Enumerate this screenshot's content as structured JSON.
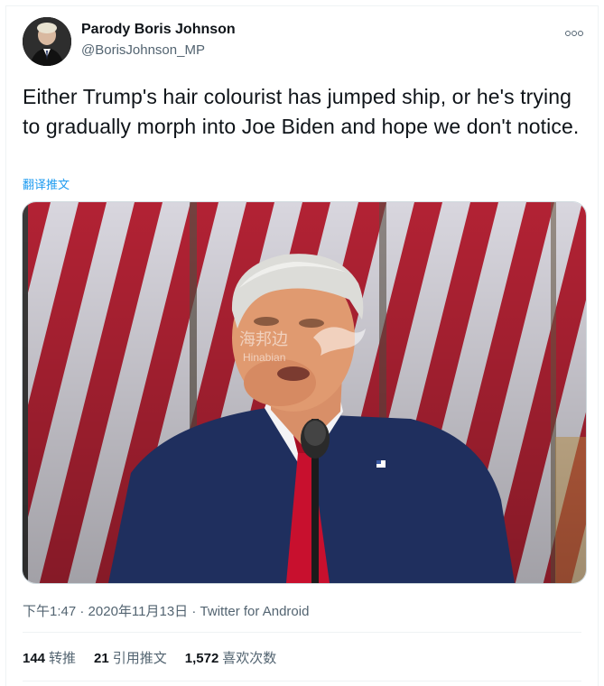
{
  "tweet": {
    "display_name": "Parody Boris Johnson",
    "handle": "@BorisJohnson_MP",
    "text": "Either Trump's hair colourist has jumped ship, or he's trying to gradually morph into Joe Biden and hope we don't notice.",
    "translate_label": "翻译推文",
    "time": "下午1:47",
    "separator1": " · ",
    "date": "2020年11月13日",
    "separator2": " · ",
    "source": "Twitter for Android"
  },
  "media": {
    "watermark_cn": "海邦边",
    "watermark_en": "Hinabian"
  },
  "stats": {
    "retweets_count": "144",
    "retweets_label": "转推",
    "quotes_count": "21",
    "quotes_label": "引用推文",
    "likes_count": "1,572",
    "likes_label": "喜欢次数"
  },
  "colors": {
    "link": "#1d9bf0",
    "secondary_text": "#536471",
    "stripe_red": "#b22234",
    "suit": "#1f2f5e",
    "tie": "#c8102e"
  },
  "icons": {
    "more": "more-horizontal-icon"
  }
}
